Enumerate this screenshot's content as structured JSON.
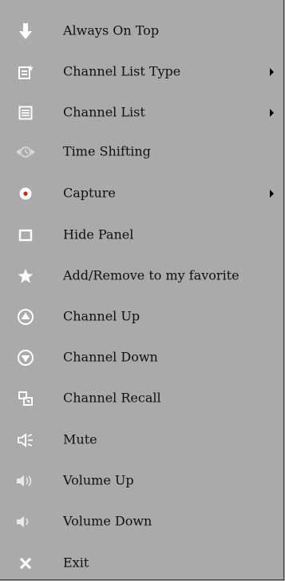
{
  "menu": {
    "items": [
      {
        "label": "Always On Top",
        "icon": "down-arrow-icon",
        "submenu": false
      },
      {
        "label": "Channel List Type",
        "icon": "channel-list-type-icon",
        "submenu": true
      },
      {
        "label": "Channel List",
        "icon": "list-icon",
        "submenu": true
      },
      {
        "label": "Time Shifting",
        "icon": "time-shifting-icon",
        "submenu": false
      },
      {
        "label": "Capture",
        "icon": "capture-icon",
        "submenu": true
      },
      {
        "label": "Hide Panel",
        "icon": "hide-panel-icon",
        "submenu": false
      },
      {
        "label": "Add/Remove to my favorite",
        "icon": "star-icon",
        "submenu": false
      },
      {
        "label": "Channel Up",
        "icon": "channel-up-icon",
        "submenu": false
      },
      {
        "label": "Channel Down",
        "icon": "channel-down-icon",
        "submenu": false
      },
      {
        "label": "Channel Recall",
        "icon": "channel-recall-icon",
        "submenu": false
      },
      {
        "label": "Mute",
        "icon": "mute-icon",
        "submenu": false
      },
      {
        "label": "Volume Up",
        "icon": "volume-up-icon",
        "submenu": false
      },
      {
        "label": "Volume Down",
        "icon": "volume-down-icon",
        "submenu": false
      },
      {
        "label": "Exit",
        "icon": "close-icon",
        "submenu": false
      }
    ]
  },
  "colors": {
    "background": "#aaaaaa",
    "icon": "#ffffff",
    "text": "#101010",
    "capture_dot": "#cc2222"
  }
}
